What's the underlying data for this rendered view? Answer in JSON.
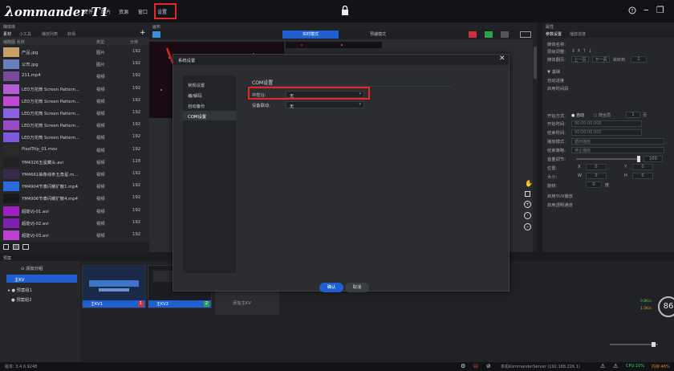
{
  "app": {
    "logo": "ommander T1",
    "menu": [
      "文件",
      "图片",
      "资源",
      "窗口",
      "设置"
    ]
  },
  "media_panel": {
    "title": "媒体库",
    "tabs": [
      "素材",
      "小工具",
      "播放列表",
      "转场"
    ],
    "columns": [
      "缩略图 名称",
      "类型",
      "分辨"
    ],
    "rows": [
      {
        "name": "产品.jpg",
        "type": "图片",
        "size": "192"
      },
      {
        "name": "公司.jpg",
        "type": "图片",
        "size": "192"
      },
      {
        "name": "211.mp4",
        "type": "视频",
        "size": "192"
      },
      {
        "name": "LED万花筒 Screen Pattern...",
        "type": "视频",
        "size": "192"
      },
      {
        "name": "LED万花筒 Screen Pattern...",
        "type": "视频",
        "size": "192"
      },
      {
        "name": "LED万花筒 Screen Pattern...",
        "type": "视频",
        "size": "192"
      },
      {
        "name": "LED万花筒 Screen Pattern...",
        "type": "视频",
        "size": "192"
      },
      {
        "name": "LED万花筒 Screen Pattern...",
        "type": "视频",
        "size": "192"
      },
      {
        "name": "PixelTrip_01.mov",
        "type": "视频",
        "size": "192"
      },
      {
        "name": "YM4326五星藏头.avi",
        "type": "视频",
        "size": "128"
      },
      {
        "name": "YM4661抽象线条五角星.m...",
        "type": "视频",
        "size": "192"
      },
      {
        "name": "YM4904节奏闪耀扩散1.mp4",
        "type": "视频",
        "size": "192"
      },
      {
        "name": "YM4906节奏闪耀扩散4.mp4",
        "type": "视频",
        "size": "192"
      },
      {
        "name": "超能VJ-01.avi",
        "type": "视频",
        "size": "192"
      },
      {
        "name": "超能VJ-02.avi",
        "type": "视频",
        "size": "192"
      },
      {
        "name": "超能VJ-03.avi",
        "type": "视频",
        "size": "192"
      }
    ]
  },
  "canvas": {
    "title": "画布",
    "mode_live": "实时模式",
    "mode_preview": "预编模式"
  },
  "dialog": {
    "title": "系统设置",
    "sidebar": [
      "常规设置",
      "编/解码",
      "自动备份",
      "COM设置"
    ],
    "section_title": "COM设置",
    "fields": [
      {
        "label": "中控台:",
        "value": "无"
      },
      {
        "label": "设备联动:",
        "value": "无"
      }
    ],
    "confirm": "确认",
    "cancel": "取消"
  },
  "properties": {
    "title": "属性",
    "tabs": [
      "参数设置",
      "播放进度"
    ],
    "media_name_label": "媒体名称:",
    "rows": [
      "层级调整:",
      "媒体翻页:",
      "▼ 基础",
      "自动进度",
      "启用时间段",
      "开始方式:",
      "开始时间:",
      "结束时间:",
      "播放模式:",
      "结束策略:",
      "音量调节:",
      "位置:",
      "大小:",
      "旋转:",
      "启用YUV播放",
      "启用透明通道"
    ],
    "page_first": "上一页",
    "page_next": "下一页",
    "page_jump": "跳转到",
    "page_num": "1",
    "start_auto": "自动",
    "start_follow": "随全局",
    "start_page": "1",
    "start_unit": "页",
    "start_time": "00:00:00.000",
    "end_time": "00:00:00.000",
    "play_mode": "循环播放",
    "end_mode": "停止播放",
    "volume": "100",
    "pos_x_label": "X",
    "pos_x": "0",
    "pos_y_label": "Y",
    "pos_y": "0",
    "size_w_label": "W",
    "size_w": "0",
    "size_h_label": "H",
    "size_h": "0",
    "rotate": "0",
    "rotate_unit": "度"
  },
  "presets": {
    "title": "预案",
    "add_group": "添加分组",
    "groups": [
      "主KV",
      "预案组1",
      "预案组2"
    ],
    "cards": [
      {
        "label": "主KV1",
        "num": "1"
      },
      {
        "label": "主KV2",
        "num": "2"
      }
    ],
    "tooltip": "添加主KV"
  },
  "status": {
    "version": "版本: 3.4.0.9248",
    "server": "本机KommanderServer (192.168.226.1)",
    "cpu": "CPU:10%",
    "mem": "内存:46%",
    "speed_up": "0.8K/s",
    "speed_down": "1.5K/s",
    "percent": "86"
  },
  "colors": {
    "accent": "#1f5fcf",
    "highlight": "#e8262a"
  }
}
